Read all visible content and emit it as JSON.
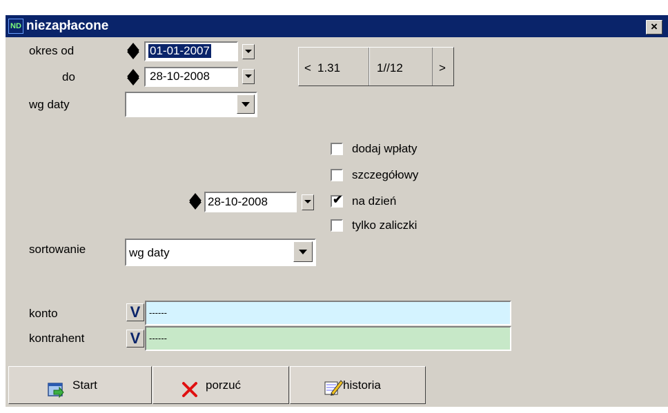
{
  "window": {
    "title": "niezapłacone",
    "close_symbol": "×"
  },
  "period": {
    "from_label": "okres od",
    "to_label": "do",
    "from_value": "01-01-2007",
    "to_value": "28-10-2008",
    "by_date_label": "wg daty",
    "by_date_value": ""
  },
  "pager": {
    "prev_symbol": "<",
    "next_symbol": ">",
    "left_value": "1.31",
    "right_value": "1//12"
  },
  "options": {
    "add_payments": {
      "label": "dodaj wpłaty",
      "checked": false
    },
    "detailed": {
      "label": "szczegółowy",
      "checked": false
    },
    "on_day": {
      "label": "na dzień",
      "checked": true
    },
    "advances_only": {
      "label": "tylko zaliczki",
      "checked": false
    },
    "on_day_date": "28-10-2008"
  },
  "sorting": {
    "label": "sortowanie",
    "value": "wg daty"
  },
  "account": {
    "label": "konto",
    "value": "------",
    "select_symbol": "V",
    "field_color": "#d4f3ff"
  },
  "contractor": {
    "label": "kontrahent",
    "value": "------",
    "select_symbol": "V",
    "field_color": "#c7e8c8"
  },
  "buttons": {
    "start_label": "Start",
    "abandon_label": "porzuć",
    "history_label": "historia"
  },
  "icons": {
    "app": "app-logo-icon",
    "start": "start-arrow-icon",
    "abandon": "red-x-icon",
    "history": "notepad-pencil-icon"
  }
}
